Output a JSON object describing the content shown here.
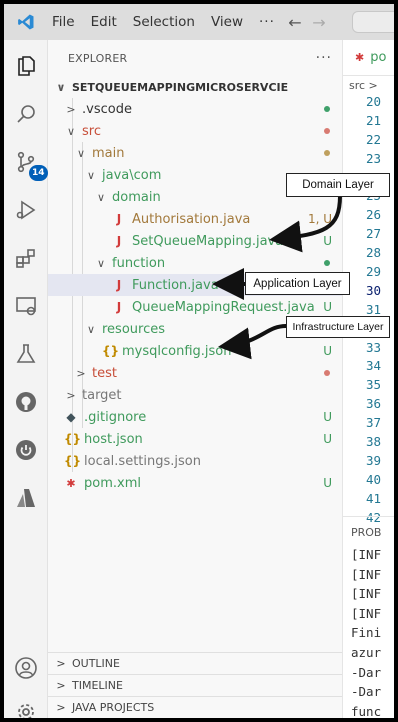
{
  "titlebar": {
    "menus": [
      "File",
      "Edit",
      "Selection",
      "View"
    ],
    "more": "···"
  },
  "activity": {
    "source_control_badge": "14"
  },
  "explorer": {
    "title": "EXPLORER",
    "more": "···",
    "root": "SETQUEUEMAPPINGMICROSERVCIE",
    "items": [
      {
        "label": ".vscode",
        "status": "",
        "dot": "green"
      },
      {
        "label": "src",
        "status": "",
        "dot": "red"
      },
      {
        "label": "main",
        "status": "",
        "dot": "gold"
      },
      {
        "label": "java\\com",
        "status": "",
        "dot": ""
      },
      {
        "label": "domain",
        "status": "",
        "dot": ""
      },
      {
        "label": "Authorisation.java",
        "status": "1, U",
        "dot": ""
      },
      {
        "label": "SetQueueMapping.java",
        "status": "U",
        "dot": ""
      },
      {
        "label": "function",
        "status": "",
        "dot": "green"
      },
      {
        "label": "Function.java",
        "status": "",
        "dot": ""
      },
      {
        "label": "QueueMappingRequest.java",
        "status": "U",
        "dot": ""
      },
      {
        "label": "resources",
        "status": "",
        "dot": ""
      },
      {
        "label": "mysqlconfig.json",
        "status": "U",
        "dot": ""
      },
      {
        "label": "test",
        "status": "",
        "dot": "red"
      },
      {
        "label": "target",
        "status": "",
        "dot": ""
      },
      {
        "label": ".gitignore",
        "status": "U",
        "dot": ""
      },
      {
        "label": "host.json",
        "status": "U",
        "dot": ""
      },
      {
        "label": "local.settings.json",
        "status": "",
        "dot": ""
      },
      {
        "label": "pom.xml",
        "status": "U",
        "dot": ""
      }
    ],
    "sections": [
      "OUTLINE",
      "TIMELINE",
      "JAVA PROJECTS"
    ]
  },
  "editor": {
    "tab_label": "po",
    "breadcrumb": "src >",
    "line_numbers": [
      "20",
      "21",
      "22",
      "23",
      "24",
      "25",
      "26",
      "27",
      "28",
      "29",
      "30",
      "31",
      "32",
      "33",
      "34",
      "35",
      "36",
      "37",
      "38",
      "39",
      "40",
      "41",
      "42"
    ],
    "current_line": "30",
    "panel_title": "PROB",
    "terminal_lines": [
      "[INF",
      "[INF",
      "[INF",
      "[INF",
      "Fini",
      "azur",
      "-Dar",
      "-Dar",
      "func"
    ]
  },
  "annotations": {
    "domain_layer": "Domain Layer",
    "application_layer": "Application Layer",
    "infrastructure_layer": "Infrastructure Layer"
  },
  "colors": {
    "accent": "#005fb8",
    "git_untracked": "#3f9a5c",
    "git_modified": "#c74e39"
  }
}
